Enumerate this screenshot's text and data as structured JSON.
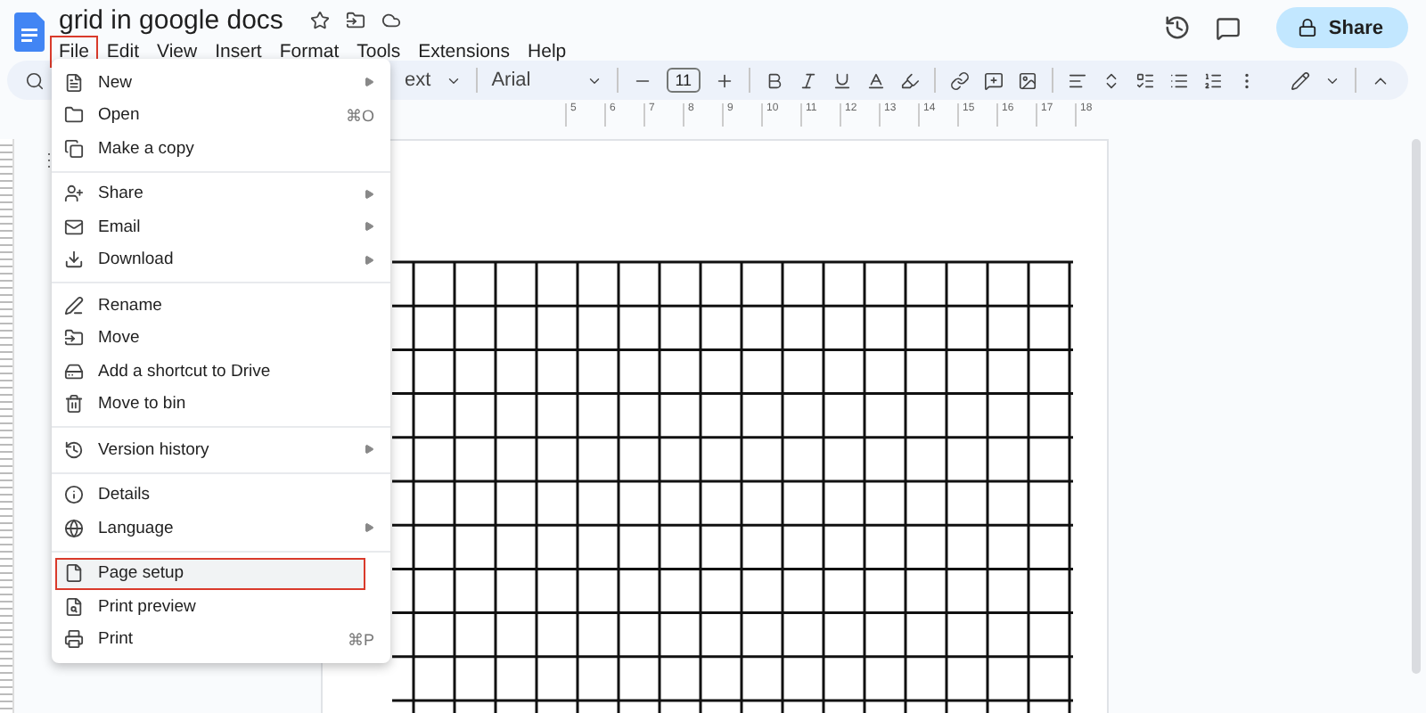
{
  "document": {
    "title": "grid in google docs"
  },
  "menubar": [
    {
      "label": "File",
      "selected": true
    },
    {
      "label": "Edit",
      "selected": false
    },
    {
      "label": "View",
      "selected": false
    },
    {
      "label": "Insert",
      "selected": false
    },
    {
      "label": "Format",
      "selected": false
    },
    {
      "label": "Tools",
      "selected": false
    },
    {
      "label": "Extensions",
      "selected": false
    },
    {
      "label": "Help",
      "selected": false
    }
  ],
  "share_button": {
    "label": "Share"
  },
  "toolbar": {
    "style": "ext",
    "font": "Arial",
    "font_size": "11"
  },
  "ruler": [
    "5",
    "6",
    "7",
    "8",
    "9",
    "10",
    "11",
    "12",
    "13",
    "14",
    "15",
    "16",
    "17",
    "18"
  ],
  "file_menu": [
    [
      {
        "label": "New",
        "submenu": true,
        "selected": false
      },
      {
        "label": "Open",
        "shortcut": "⌘O",
        "submenu": false,
        "selected": false
      },
      {
        "label": "Make a copy",
        "submenu": false,
        "selected": false
      }
    ],
    [
      {
        "label": "Share",
        "submenu": true,
        "selected": false
      },
      {
        "label": "Email",
        "submenu": true,
        "selected": false
      },
      {
        "label": "Download",
        "submenu": true,
        "selected": false
      }
    ],
    [
      {
        "label": "Rename",
        "submenu": false,
        "selected": false
      },
      {
        "label": "Move",
        "submenu": false,
        "selected": false
      },
      {
        "label": "Add a shortcut to Drive",
        "submenu": false,
        "selected": false
      },
      {
        "label": "Move to bin",
        "submenu": false,
        "selected": false
      }
    ],
    [
      {
        "label": "Version history",
        "submenu": true,
        "selected": false
      }
    ],
    [
      {
        "label": "Details",
        "submenu": false,
        "selected": false
      },
      {
        "label": "Language",
        "submenu": true,
        "selected": false
      }
    ],
    [
      {
        "label": "Page setup",
        "submenu": false,
        "selected": true
      },
      {
        "label": "Print preview",
        "submenu": false,
        "selected": false
      },
      {
        "label": "Print",
        "shortcut": "⌘P",
        "submenu": false,
        "selected": false
      }
    ]
  ]
}
